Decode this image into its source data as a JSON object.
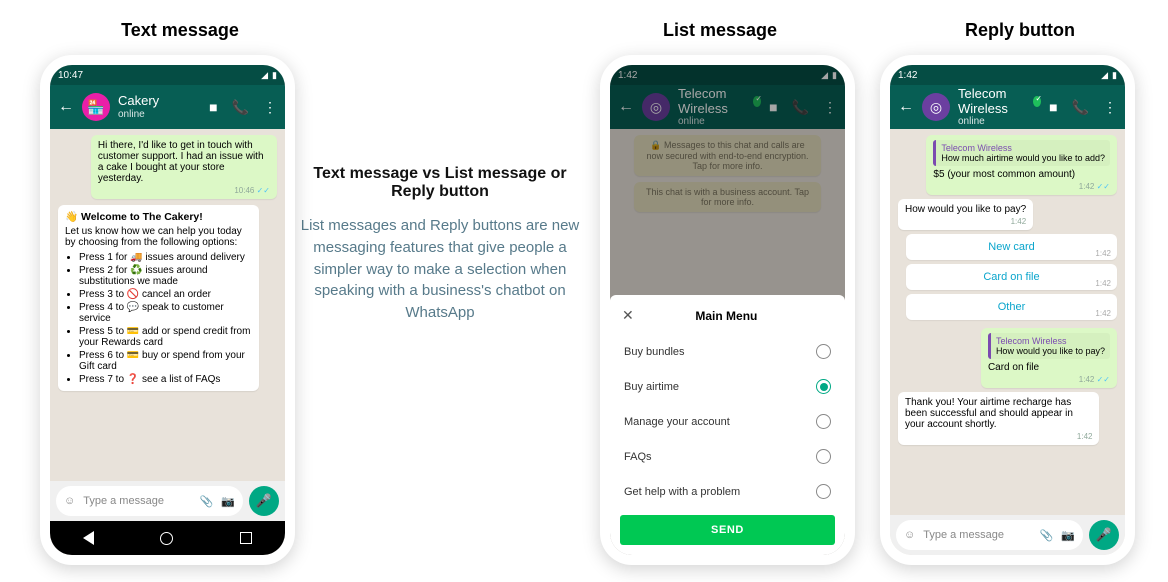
{
  "titles": {
    "text_message": "Text message",
    "list_message": "List message",
    "reply_button": "Reply button"
  },
  "center": {
    "heading": "Text message vs List message or Reply button",
    "body": "List messages and Reply buttons are new messaging features that give people a simpler way to make a selection when speaking with a business's chatbot on WhatsApp"
  },
  "common": {
    "status_time": "10:47",
    "status_time_alt": "1:42",
    "online": "online",
    "type_message": "Type a message",
    "msg_time": "10:46",
    "reply_time": "1:42"
  },
  "phone1": {
    "contact": "Cakery",
    "user_msg": "Hi there, I'd like to get in touch with customer support. I had an issue with a cake I bought at your store yesterday.",
    "welcome_title": "👋 Welcome to The Cakery!",
    "welcome_body": "Let us know how we can help you today by choosing from the following options:",
    "menu": [
      "Press 1 for 🚚 issues around delivery",
      "Press 2 for ♻️ issues around substitutions we made",
      "Press 3 to 🚫 cancel an order",
      "Press 4 to 💬 speak to customer service",
      "Press 5 to 💳 add or spend credit from your Rewards card",
      "Press 6 to 💳 buy or spend from your Gift card",
      "Press 7 to ❓ see a list of FAQs"
    ]
  },
  "phone2": {
    "contact": "Telecom Wireless",
    "sys1": "🔒 Messages to this chat and calls are now secured with end-to-end encryption. Tap for more info.",
    "sys2": "This chat is with a business account. Tap for more info.",
    "sheet_title": "Main Menu",
    "options": [
      "Buy bundles",
      "Buy airtime",
      "Manage your account",
      "FAQs",
      "Get help with a problem"
    ],
    "selected_index": 1,
    "send": "SEND"
  },
  "phone3": {
    "contact": "Telecom Wireless",
    "q1_name": "Telecom Wireless",
    "q1_text": "How much airtime would you like to add?",
    "reply1": "$5 (your most common amount)",
    "biz_q": "How would you like to pay?",
    "options": [
      "New card",
      "Card on file",
      "Other"
    ],
    "q2_text": "How would you like to pay?",
    "reply2": "Card on file",
    "final": "Thank you! Your airtime recharge has been successful and should appear in your account shortly."
  }
}
